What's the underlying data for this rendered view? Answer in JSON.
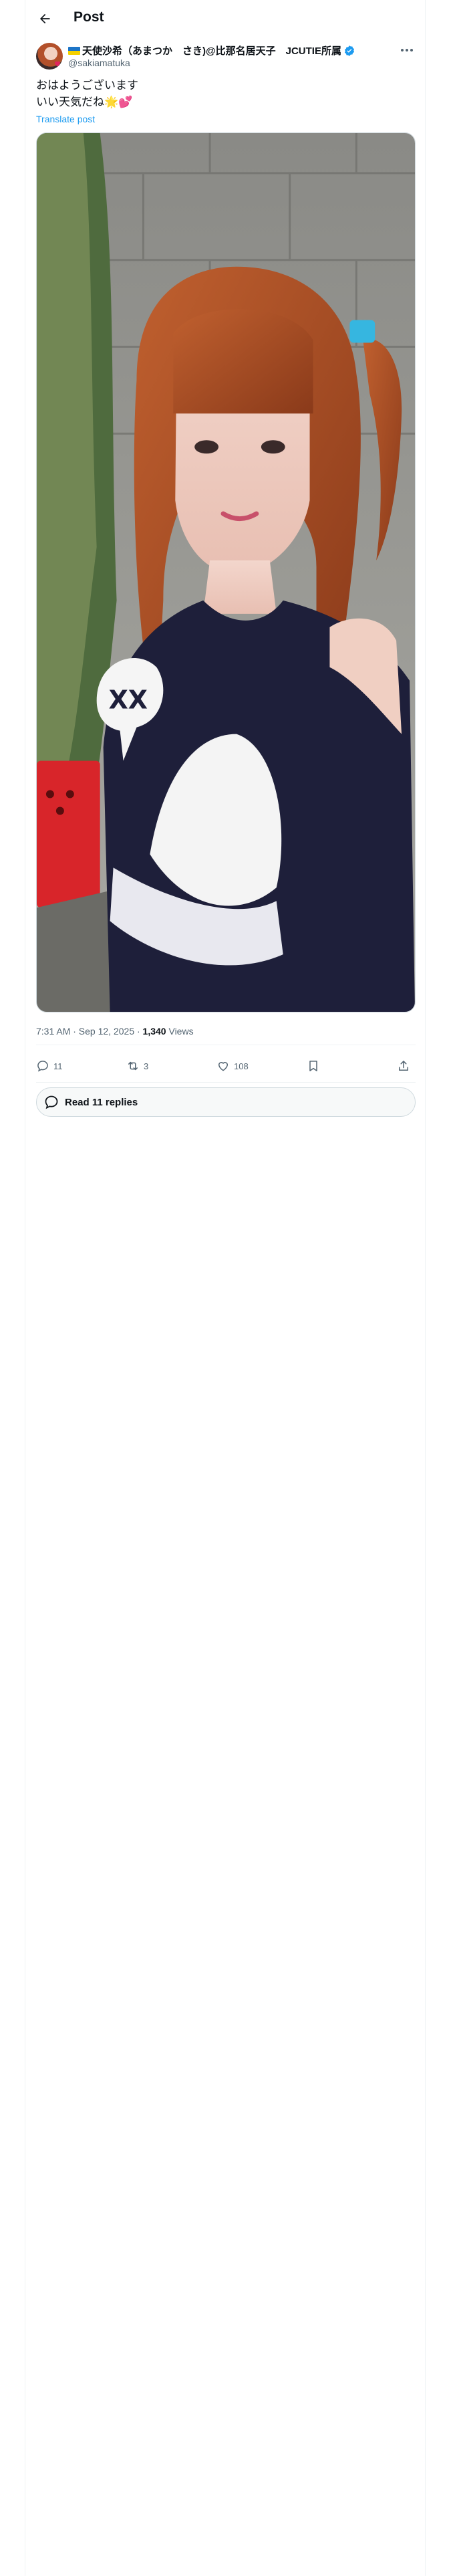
{
  "header": {
    "title": "Post"
  },
  "author": {
    "display_name": "天使沙希（あまつか　さき)@比那名居天子　JCUTIE所属",
    "handle": "@sakiamatuka"
  },
  "post": {
    "text": "おはようございます\nいい天気だね🌟💕",
    "translate_label": "Translate post",
    "time": "7:31 AM · Sep 12, 2025 · ",
    "views_count": "1,340",
    "views_label": " Views"
  },
  "actions": {
    "replies": "11",
    "reposts": "3",
    "likes": "108"
  },
  "read_replies": {
    "label": "Read 11 replies"
  },
  "colors": {
    "accent": "#1d9bf0",
    "text": "#0f1419",
    "secondary_text": "#536471",
    "border": "#eff3f4"
  }
}
